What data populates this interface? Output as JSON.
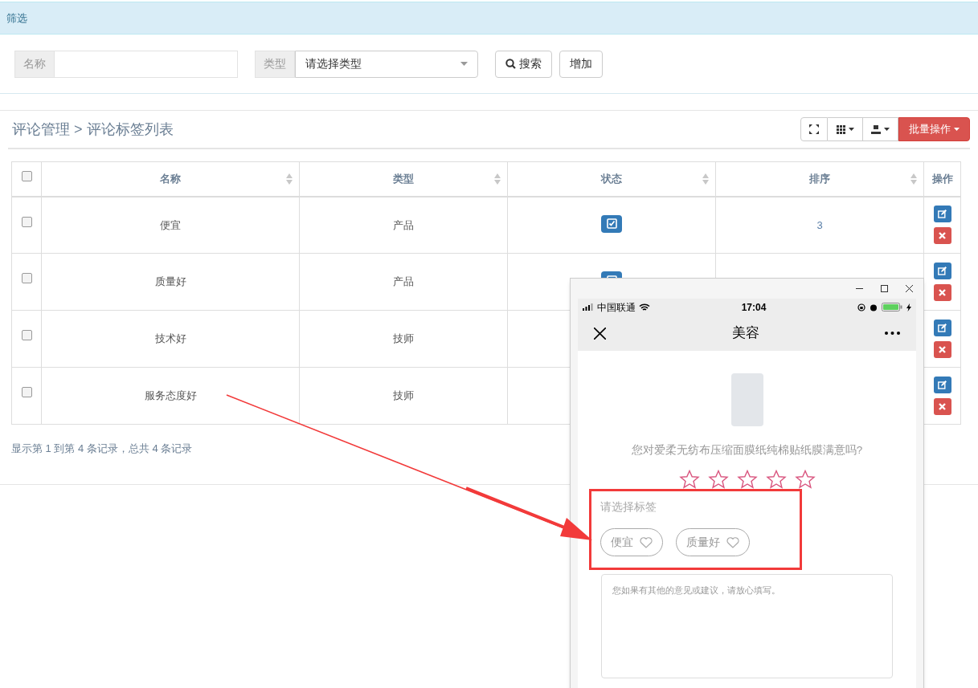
{
  "filter_panel": {
    "title": "筛选",
    "name_field": {
      "label": "名称"
    },
    "type_field": {
      "label": "类型",
      "value": "请选择类型"
    },
    "buttons": [
      {
        "kind": "search",
        "label": "搜索"
      },
      {
        "kind": "plain",
        "label": "增加"
      }
    ]
  },
  "breadcrumb": "评论管理 > 评论标签列表",
  "toolbar": {
    "batch_button": "批量操作"
  },
  "table": {
    "columns": [
      "名称",
      "类型",
      "状态",
      "排序",
      "操作"
    ],
    "rows": [
      {
        "checked": false,
        "name": "便宜",
        "type": "产品",
        "status_enabled": true,
        "sort": "3"
      },
      {
        "checked": false,
        "name": "质量好",
        "type": "产品",
        "status_enabled": true
      },
      {
        "checked": false,
        "name": "技术好",
        "type": "技师"
      },
      {
        "checked": false,
        "name": "服务态度好",
        "type": "技师"
      }
    ],
    "select_all": false
  },
  "pagination_info": "显示第 1 到第 4 条记录，总共 4 条记录",
  "phone_window": {
    "carrier": "中国联通",
    "time": "17:04",
    "nav_title": "美容",
    "question": "您对爱柔无纺布压缩面膜纸纯棉贴纸膜满意吗?",
    "rating": {
      "stars": 0
    },
    "tag_prompt": "请选择标签",
    "tags": [
      {
        "label": "便宜",
        "selected": false
      },
      {
        "label": "质量好",
        "selected": false
      }
    ],
    "comment_placeholder": "您如果有其他的意见或建议，请放心填写。"
  }
}
